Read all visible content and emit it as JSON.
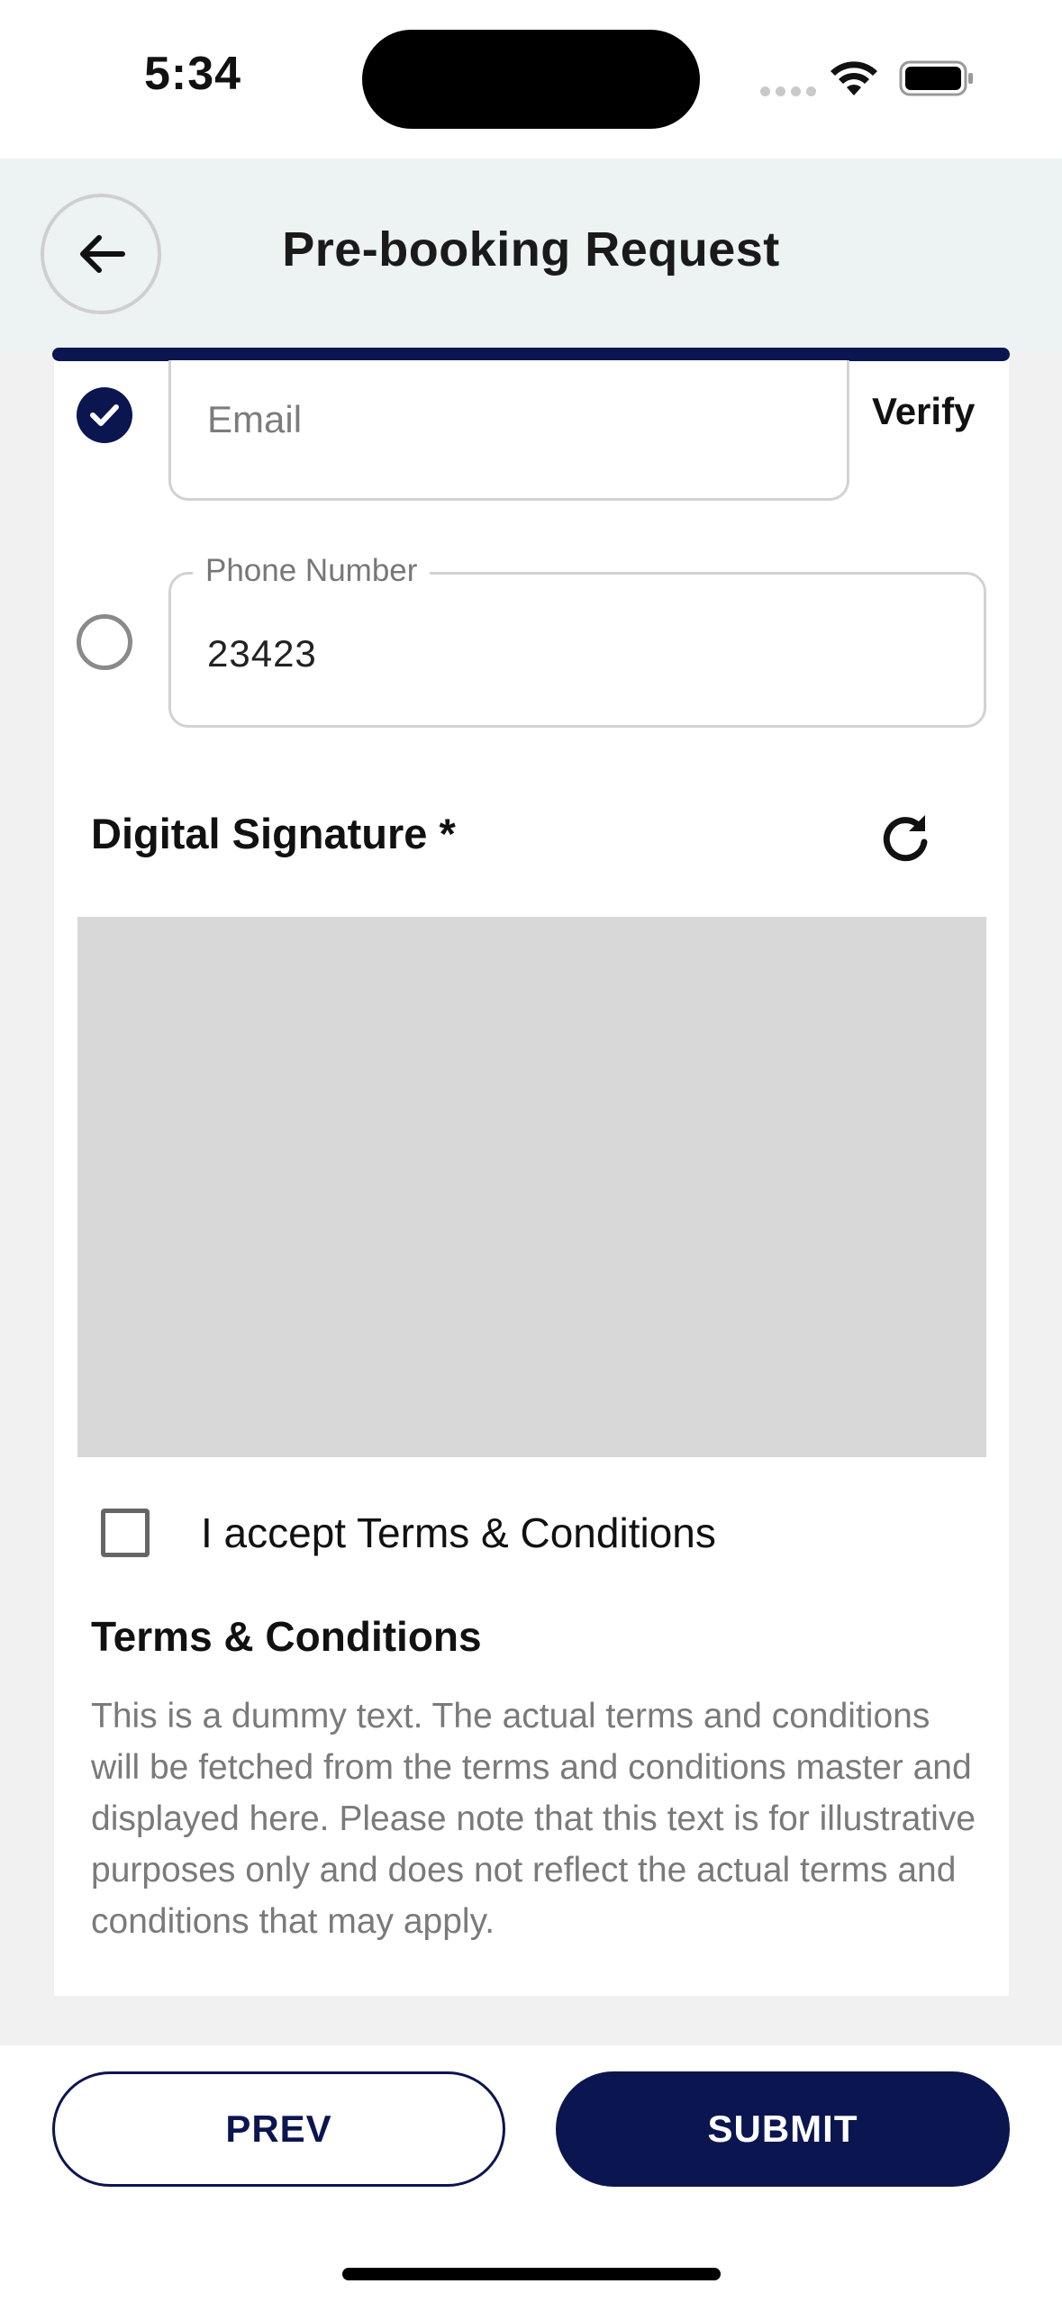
{
  "status_bar": {
    "time": "5:34"
  },
  "header": {
    "title": "Pre-booking Request",
    "back_icon": "arrow-left-icon"
  },
  "contact": {
    "email": {
      "placeholder": "Email",
      "value": "",
      "selected": true,
      "verify_label": "Verify"
    },
    "phone": {
      "label": "Phone Number",
      "value": "23423",
      "selected": false
    }
  },
  "signature": {
    "title": "Digital Signature *",
    "refresh_icon": "refresh-icon"
  },
  "terms": {
    "accept_label": "I accept Terms & Conditions",
    "accepted": false,
    "title": "Terms & Conditions",
    "body": "This is a dummy text. The actual terms and conditions will be fetched from the terms and conditions master and displayed here. Please note that this text is for illustrative purposes only and does not reflect the actual terms and conditions that may apply."
  },
  "footer": {
    "prev_label": "PREV",
    "submit_label": "SUBMIT"
  },
  "colors": {
    "primary": "#0b1550",
    "header_bg": "#edf2f3",
    "signature_pad": "#d8d8d8",
    "muted_text": "#7a7a7a"
  }
}
